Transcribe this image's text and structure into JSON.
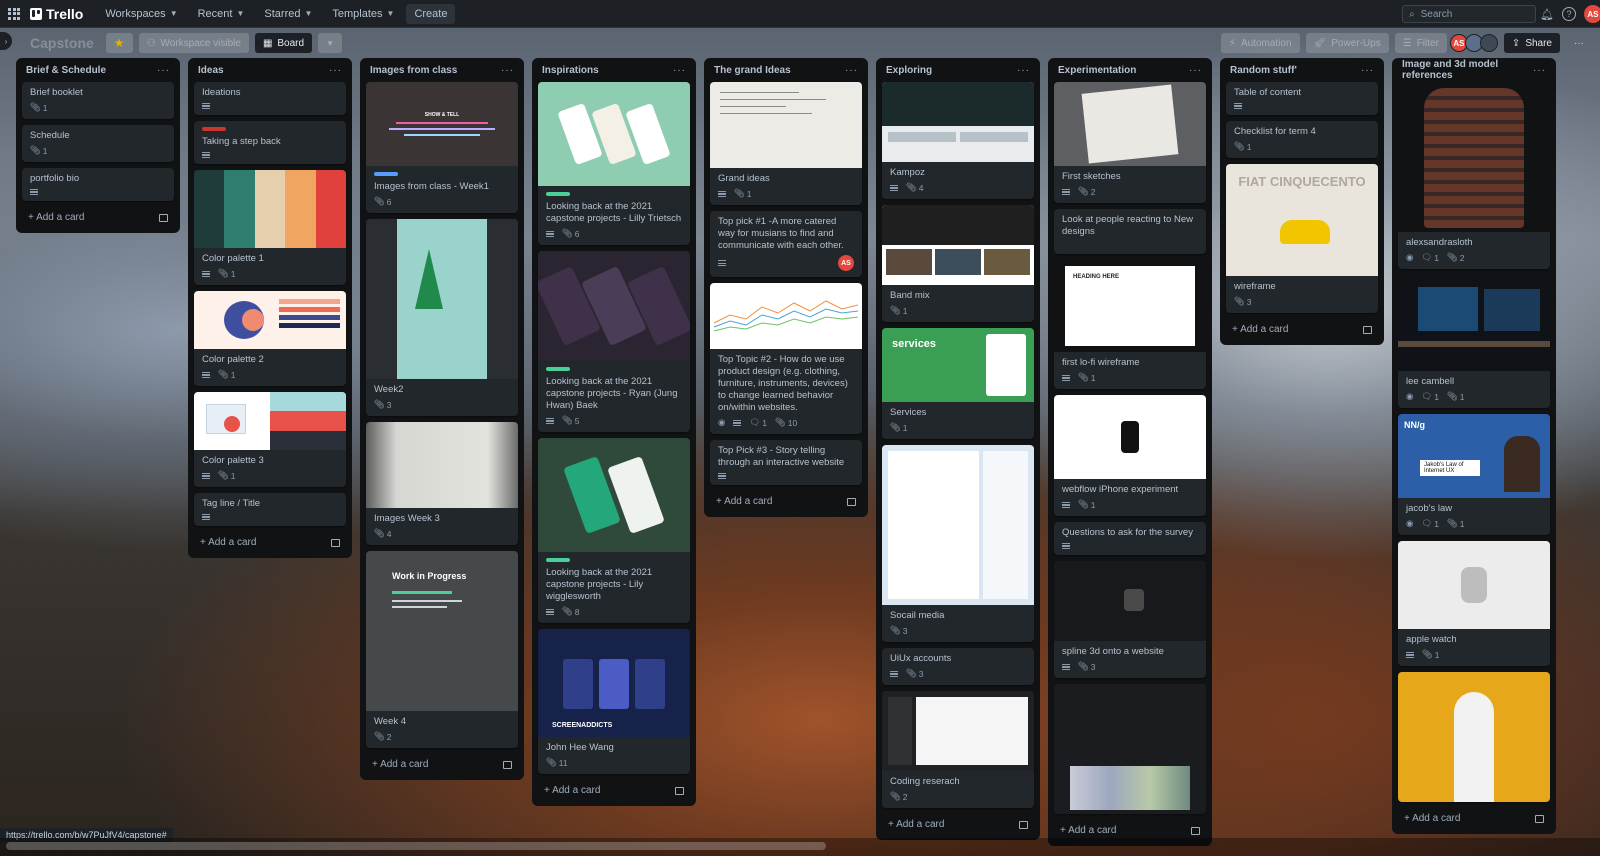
{
  "nav": {
    "brand": "Trello",
    "workspaces": "Workspaces",
    "recent": "Recent",
    "starred": "Starred",
    "templates": "Templates",
    "create": "Create",
    "search_placeholder": "Search",
    "user_initials": "AS"
  },
  "boardbar": {
    "title": "Capstone",
    "visibility": "Workspace visible",
    "view": "Board",
    "automation": "Automation",
    "powerups": "Power-Ups",
    "filter": "Filter",
    "share": "Share",
    "member_initials": "AS"
  },
  "status_url": "https://trello.com/b/w7PuJfV4/capstone#",
  "add_card": "Add a card",
  "lists": [
    {
      "title": "Brief & Schedule",
      "cards": [
        {
          "title": "Brief booklet",
          "badges": {
            "attach": "1"
          }
        },
        {
          "title": "Schedule",
          "badges": {
            "attach": "1"
          }
        },
        {
          "title": "portfolio bio",
          "badges": {
            "desc": true
          }
        }
      ]
    },
    {
      "title": "Ideas",
      "cards": [
        {
          "title": "Ideations",
          "badges": {
            "desc": true
          }
        },
        {
          "title": "Taking a step back",
          "label": "#c9372c",
          "badges": {
            "desc": true
          }
        },
        {
          "title": "Color palette 1",
          "cover": "palette1",
          "badges": {
            "desc": true,
            "attach": "1"
          }
        },
        {
          "title": "Color palette 2",
          "cover": "palette2",
          "badges": {
            "desc": true,
            "attach": "1"
          }
        },
        {
          "title": "Color palette 3",
          "cover": "palette3",
          "badges": {
            "desc": true,
            "attach": "1"
          }
        },
        {
          "title": "Tag line / Title",
          "badges": {
            "desc": true
          }
        }
      ]
    },
    {
      "title": "Images from class",
      "cards": [
        {
          "title": "Images from class - Week1",
          "cover": "slide",
          "label": "#579dff",
          "badges": {
            "attach": "6"
          }
        },
        {
          "title": "Week2",
          "cover": "tree",
          "badges": {
            "attach": "3"
          }
        },
        {
          "title": "Images Week 3",
          "cover": "whiteboard",
          "badges": {
            "attach": "4"
          }
        },
        {
          "title": "Week 4",
          "cover": "wip",
          "badges": {
            "attach": "2"
          }
        }
      ]
    },
    {
      "title": "Inspirations",
      "cards": [
        {
          "title": "Looking back at the 2021 capstone projects - Lilly Trietsch",
          "cover": "mint",
          "label": "#4bce97",
          "badges": {
            "desc": true,
            "attach": "6"
          }
        },
        {
          "title": "Looking back at the 2021 capstone projects - Ryan (Jung Hwan) Baek",
          "cover": "dark",
          "label": "#4bce97",
          "badges": {
            "desc": true,
            "attach": "5"
          }
        },
        {
          "title": "Looking back at the 2021 capstone projects - Lily wigglesworth",
          "cover": "green",
          "label": "#4bce97",
          "badges": {
            "desc": true,
            "attach": "8"
          }
        },
        {
          "title": "John Hee Wang",
          "cover": "navy",
          "badges": {
            "attach": "11"
          }
        }
      ]
    },
    {
      "title": "The grand Ideas",
      "cards": [
        {
          "title": "Grand ideas",
          "cover": "paper",
          "badges": {
            "desc": true,
            "attach": "1"
          }
        },
        {
          "title": "Top pick #1 -A more catered way for musians to find and communicate with each other.",
          "member": "AS",
          "badges": {
            "desc": true
          }
        },
        {
          "title": "Top Topic #2 - How do we use product design (e.g. clothing, furniture, instruments, devices) to change learned behavior on/within websites.",
          "cover": "chart",
          "badges": {
            "watch": true,
            "desc": true,
            "comments": "1",
            "attach": "10"
          }
        },
        {
          "title": "Top Pick #3 - Story telling through an interactive website",
          "badges": {
            "desc": true
          }
        }
      ]
    },
    {
      "title": "Exploring",
      "cards": [
        {
          "title": "Kampoz",
          "cover": "site",
          "badges": {
            "desc": true,
            "attach": "4"
          }
        },
        {
          "title": "Band mix",
          "cover": "band",
          "badges": {
            "attach": "1"
          }
        },
        {
          "title": "Services",
          "cover": "services",
          "cover_text": "services",
          "badges": {
            "attach": "1"
          }
        },
        {
          "title": "Socail media",
          "cover": "social",
          "badges": {
            "attach": "3"
          }
        },
        {
          "title": "UiUx accounts",
          "badges": {
            "desc": true,
            "attach": "3"
          }
        },
        {
          "title": "Coding reserach",
          "cover": "code",
          "badges": {
            "attach": "2"
          }
        }
      ]
    },
    {
      "title": "Experimentation",
      "cards": [
        {
          "title": "First sketches",
          "cover": "sketch",
          "badges": {
            "desc": true,
            "attach": "2"
          }
        },
        {
          "title": "Look at people reacting to New designs",
          "badges": {}
        },
        {
          "title": "first lo-fi wireframe",
          "cover": "lofi",
          "badges": {
            "desc": true,
            "attach": "1"
          }
        },
        {
          "title": "webflow iPhone experiment",
          "cover": "iphone",
          "badges": {
            "desc": true,
            "attach": "1"
          }
        },
        {
          "title": "Questions to ask for the survey",
          "badges": {
            "desc": true
          }
        },
        {
          "title": "spline 3d onto a website",
          "cover": "spline",
          "badges": {
            "desc": true,
            "attach": "3"
          }
        },
        {
          "title": "",
          "cover": "watches",
          "badges": {}
        }
      ]
    },
    {
      "title": "Random stuff'",
      "cards": [
        {
          "title": "Table of content",
          "badges": {
            "desc": true
          }
        },
        {
          "title": "Checklist for term 4",
          "badges": {
            "attach": "1"
          }
        },
        {
          "title": "wireframe",
          "cover": "fiat",
          "badges": {
            "attach": "3"
          }
        }
      ]
    },
    {
      "title": "Image and 3d model references",
      "cards": [
        {
          "title": "alexsandrasloth",
          "cover": "flannel",
          "badges": {
            "watch": true,
            "comments": "1",
            "attach": "2"
          }
        },
        {
          "title": "lee cambell",
          "cover": "desk",
          "badges": {
            "watch": true,
            "comments": "1",
            "attach": "1"
          }
        },
        {
          "title": "jacob's law",
          "cover": "nng",
          "badges": {
            "watch": true,
            "comments": "1",
            "attach": "1"
          }
        },
        {
          "title": "apple watch",
          "cover": "watch",
          "badges": {
            "desc": true,
            "attach": "1"
          }
        },
        {
          "title": "",
          "cover": "yellow",
          "badges": {}
        }
      ]
    }
  ],
  "cover_texts": {
    "services": "services",
    "fiat": "FIAT CINQUECENTO",
    "wip": "Work in Progress",
    "screen": "SCREENADDICTS",
    "nng": "Jakob's Law of Internet UX",
    "nn": "NN/g",
    "slide": "SHOW & TELL"
  }
}
